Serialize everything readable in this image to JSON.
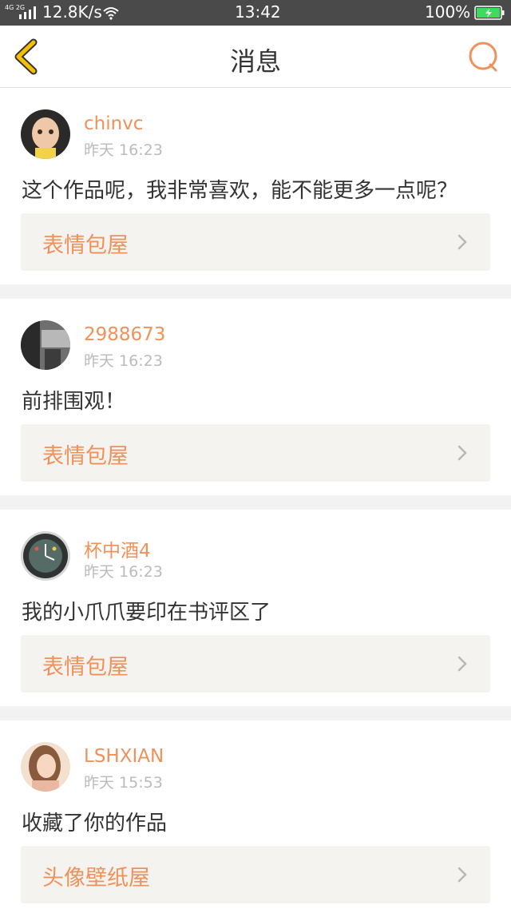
{
  "status_bar": {
    "network": "4G 2G",
    "speed": "12.8K/s",
    "time": "13:42",
    "battery": "100%"
  },
  "header": {
    "title": "消息"
  },
  "colors": {
    "accent": "#f0915a",
    "back_icon": "#f5c000",
    "text": "#333333",
    "muted": "#bbbbbb",
    "link_bg": "#f4f3ef"
  },
  "messages": [
    {
      "avatar": "avatar-baby",
      "username": "chinvc",
      "time": "昨天 16:23",
      "content": "这个作品呢，我非常喜欢，能不能更多一点呢？",
      "link": "表情包屋"
    },
    {
      "avatar": "avatar-bw-photo",
      "username": "2988673",
      "time": "昨天 16:23",
      "content": "前排围观！",
      "link": "表情包屋"
    },
    {
      "avatar": "avatar-clock",
      "username": "杯中酒4",
      "time": "昨天 16:23",
      "content": "我的小爪爪要印在书评区了",
      "link": "表情包屋"
    },
    {
      "avatar": "avatar-girl",
      "username": "LSHXIAN",
      "time": "昨天 15:53",
      "content": "收藏了你的作品",
      "link": "头像壁纸屋"
    }
  ]
}
